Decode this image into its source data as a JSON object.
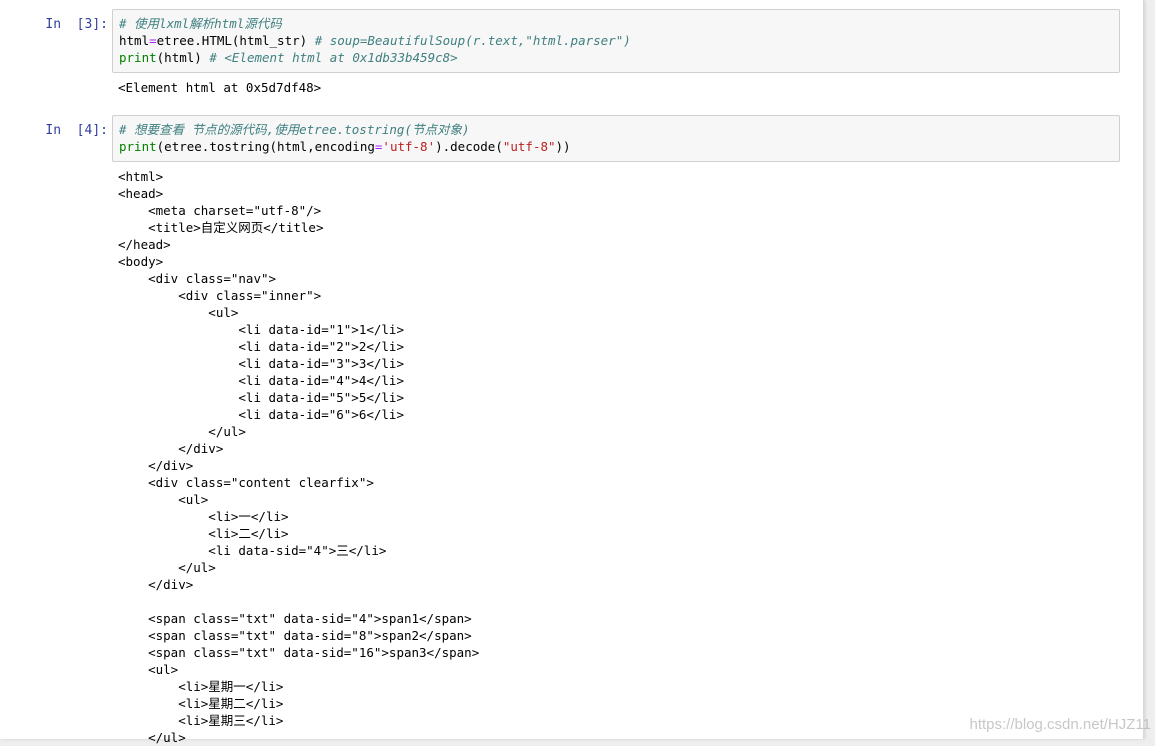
{
  "cells": [
    {
      "prompt": "In  [3]:",
      "code": {
        "line1_comment": "# 使用lxml解析html源代码",
        "line2_pre": "html",
        "line2_op": "=",
        "line2_mid": "etree.HTML(html_str) ",
        "line2_comment": "# soup=BeautifulSoup(r.text,\"html.parser\")",
        "line3_builtin": "print",
        "line3_mid": "(html) ",
        "line3_comment": "# <Element html at 0x1db33b459c8>"
      },
      "output": "<Element html at 0x5d7df48>"
    },
    {
      "prompt": "In  [4]:",
      "code": {
        "line1_comment": "# 想要查看 节点的源代码,使用etree.tostring(节点对象)",
        "line2_builtin": "print",
        "line2_a": "(etree.tostring(html,encoding",
        "line2_op": "=",
        "line2_str1": "'utf-8'",
        "line2_b": ").decode(",
        "line2_str2": "\"utf-8\"",
        "line2_c": "))"
      },
      "output_lines": [
        "<html>",
        "<head>",
        "    <meta charset=\"utf-8\"/>",
        "    <title>自定义网页</title>",
        "</head>",
        "<body>",
        "    <div class=\"nav\">",
        "        <div class=\"inner\">",
        "            <ul>",
        "                <li data-id=\"1\">1</li>",
        "                <li data-id=\"2\">2</li>",
        "                <li data-id=\"3\">3</li>",
        "                <li data-id=\"4\">4</li>",
        "                <li data-id=\"5\">5</li>",
        "                <li data-id=\"6\">6</li>",
        "            </ul>",
        "        </div>",
        "    </div>",
        "    <div class=\"content clearfix\">",
        "        <ul>",
        "            <li>一</li>",
        "            <li>二</li>",
        "            <li data-sid=\"4\">三</li>",
        "        </ul>",
        "    </div>",
        "",
        "    <span class=\"txt\" data-sid=\"4\">span1</span>",
        "    <span class=\"txt\" data-sid=\"8\">span2</span>",
        "    <span class=\"txt\" data-sid=\"16\">span3</span>",
        "    <ul>",
        "        <li>星期一</li>",
        "        <li>星期二</li>",
        "        <li>星期三</li>",
        "    </ul>"
      ]
    }
  ],
  "watermark": "https://blog.csdn.net/HJZ11"
}
